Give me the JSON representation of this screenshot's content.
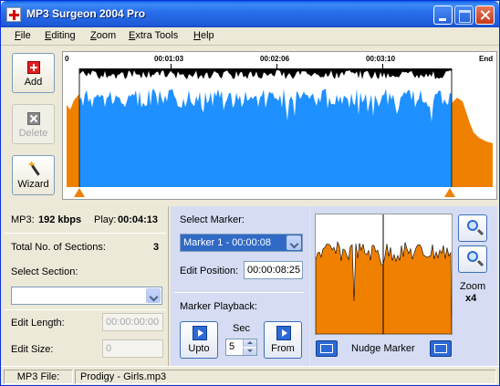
{
  "window": {
    "title": "MP3 Surgeon 2004 Pro"
  },
  "menu": [
    "File",
    "Editing",
    "Zoom",
    "Extra Tools",
    "Help"
  ],
  "toolbar": {
    "add_label": "Add",
    "delete_label": "Delete",
    "wizard_label": "Wizard"
  },
  "timeline": {
    "start": "0",
    "t1": "00:01:03",
    "t2": "00:02:06",
    "t3": "00:03:10",
    "end": "End"
  },
  "colors": {
    "waveform": "#1e90ff",
    "section": "#f08000",
    "peak": "#000000"
  },
  "info": {
    "mp3_label": "MP3:",
    "bitrate": "192 kbps",
    "play_label": "Play:",
    "play_time": "00:04:13",
    "sections_label": "Total No. of Sections:",
    "sections_value": "3",
    "select_section_label": "Select Section:",
    "select_section_value": "",
    "edit_length_label": "Edit Length:",
    "edit_length_value": "00:00:00:00",
    "edit_size_label": "Edit Size:",
    "edit_size_value": "0"
  },
  "marker": {
    "select_label": "Select Marker:",
    "selected": "Marker 1 - 00:00:08",
    "edit_position_label": "Edit Position:",
    "edit_position_value": "00:00:08:25",
    "playback_label": "Marker Playback:",
    "sec_label": "Sec",
    "sec_value": "5",
    "upto_label": "Upto",
    "from_label": "From"
  },
  "zoom": {
    "label": "Zoom",
    "factor": "x4",
    "nudge_label": "Nudge Marker"
  },
  "status": {
    "file_label": "MP3 File:",
    "file_name": "Prodigy - Girls.mp3"
  }
}
